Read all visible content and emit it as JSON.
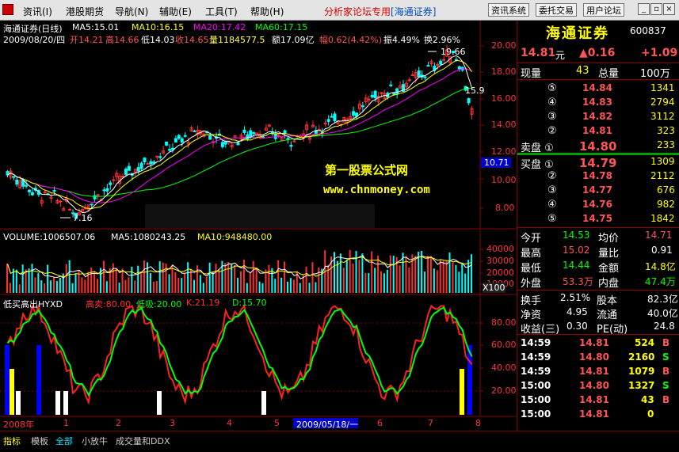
{
  "menu": {
    "items": [
      "资讯(I)",
      "港股期货",
      "导航(N)",
      "辅助(E)",
      "工具(T)",
      "帮助(H)"
    ],
    "special_text": "分析家论坛专用",
    "special_link": "[海通证券]",
    "right_buttons": [
      "资讯系统",
      "委托交易",
      "用户论坛"
    ]
  },
  "chart": {
    "title": "海通证券(日线)",
    "ma_info": [
      {
        "label": "MA5:15.01",
        "color": "#ffffff"
      },
      {
        "label": "MA10:16.15",
        "color": "#ffff00"
      },
      {
        "label": "MA20:17.42",
        "color": "#ff00ff"
      },
      {
        "label": "MA60:17.15",
        "color": "#00ff00"
      }
    ],
    "date_line": "2009/08/20/四",
    "ohlc": [
      {
        "text": "开14.21",
        "color": "#ff5555"
      },
      {
        "text": "高14.66",
        "color": "#ff5555"
      },
      {
        "text": "低14.03",
        "color": "#ffffff"
      },
      {
        "text": "收14.65",
        "color": "#ff5555"
      },
      {
        "text": "量1184577.5",
        "color": "#ffff55"
      },
      {
        "text": "额17.09亿",
        "color": "#ffffff"
      },
      {
        "text": "幅0.62(4.42%)",
        "color": "#ff5555"
      },
      {
        "text": "振4.49%",
        "color": "#ffffff"
      },
      {
        "text": "换2.96%",
        "color": "#ffffff"
      }
    ],
    "watermark1": "第一股票公式网",
    "watermark2": "www.chnmoney.com",
    "high_label": "19.66",
    "low_label": "7.16",
    "mid_label": "15.9",
    "price_tag": "10.71",
    "price_axis": [
      "20.00",
      "18.00",
      "16.00",
      "14.00",
      "12.00",
      "10.00",
      "8.00"
    ],
    "volume_info": [
      {
        "label": "VOLUME:1006507.06",
        "color": "#ffffff"
      },
      {
        "label": "MA5:1080243.25",
        "color": "#ffffff"
      },
      {
        "label": "MA10:948480.00",
        "color": "#ffff00"
      }
    ],
    "volume_axis": [
      "40000",
      "30000",
      "20000",
      "10000"
    ],
    "volume_unit": "X100",
    "indicator_name": "低买高出HYXD",
    "indicator_values": [
      {
        "text": "高卖:80.00",
        "color": "#ff3333"
      },
      {
        "text": "低吸:20.00",
        "color": "#00ff00"
      },
      {
        "text": "K:21.19",
        "color": "#ff3333"
      },
      {
        "text": "D:15.70",
        "color": "#00ff00"
      }
    ],
    "indicator_axis": [
      "80.00",
      "60.00",
      "40.00",
      "20.00"
    ],
    "time_axis": [
      "2008年",
      "1",
      "2",
      "3",
      "4",
      "5",
      "6",
      "7",
      "8"
    ],
    "date_tag": "2009/05/18/一"
  },
  "panel": {
    "stock_name": "海通证券",
    "stock_code": "600837",
    "price": "14.81",
    "price_unit": "元",
    "change": "▲0.16",
    "change_pct": "+1.09",
    "xianliang_label": "现量",
    "xianliang": "43",
    "zongliang_label": "总量",
    "zongliang": "100万",
    "sell": [
      {
        "label": "⑤",
        "price": "14.84",
        "vol": "1341"
      },
      {
        "label": "④",
        "price": "14.83",
        "vol": "2794"
      },
      {
        "label": "③",
        "price": "14.82",
        "vol": "3112"
      },
      {
        "label": "②",
        "price": "14.81",
        "vol": "323"
      },
      {
        "label": "卖盘 ①",
        "price": "14.80",
        "vol": "233"
      }
    ],
    "buy": [
      {
        "label": "买盘 ①",
        "price": "14.79",
        "vol": "1309"
      },
      {
        "label": "②",
        "price": "14.78",
        "vol": "2112"
      },
      {
        "label": "③",
        "price": "14.77",
        "vol": "676"
      },
      {
        "label": "④",
        "price": "14.76",
        "vol": "982"
      },
      {
        "label": "⑤",
        "price": "14.75",
        "vol": "1842"
      }
    ],
    "stats": [
      {
        "l1": "今开",
        "v1": "14.53",
        "c1": "#00ff00",
        "l2": "均价",
        "v2": "14.71",
        "c2": "#ff5555"
      },
      {
        "l1": "最高",
        "v1": "15.02",
        "c1": "#ff5555",
        "l2": "量比",
        "v2": "0.91",
        "c2": "#ffffff"
      },
      {
        "l1": "最低",
        "v1": "14.44",
        "c1": "#00ff00",
        "l2": "金额",
        "v2": "14.8亿",
        "c2": "#ffff00"
      },
      {
        "l1": "外盘",
        "v1": "53.3万",
        "c1": "#ff5555",
        "l2": "内盘",
        "v2": "47.4万",
        "c2": "#00ff00"
      }
    ],
    "fund": [
      {
        "l1": "换手",
        "v1": "2.51%",
        "l2": "股本",
        "v2": "82.3亿"
      },
      {
        "l1": "净资",
        "v1": "4.95",
        "l2": "流通",
        "v2": "40.0亿"
      },
      {
        "l1": "收益(三)",
        "v1": "0.30",
        "l2": "PE(动)",
        "v2": "24.8"
      }
    ],
    "ticks": [
      {
        "time": "14:59",
        "price": "14.81",
        "vol": "524",
        "dir": "B",
        "color": "#ff5555"
      },
      {
        "time": "14:59",
        "price": "14.80",
        "vol": "2160",
        "dir": "S",
        "color": "#00ff00"
      },
      {
        "time": "14:59",
        "price": "14.81",
        "vol": "1079",
        "dir": "B",
        "color": "#ff5555"
      },
      {
        "time": "15:00",
        "price": "14.80",
        "vol": "1327",
        "dir": "S",
        "color": "#00ff00"
      },
      {
        "time": "15:00",
        "price": "14.81",
        "vol": "43",
        "dir": "B",
        "color": "#ff5555"
      },
      {
        "time": "15:00",
        "price": "14.81",
        "vol": "0",
        "dir": "",
        "color": "#ffff00"
      }
    ]
  },
  "tabs": [
    "指标",
    "模板",
    "全部",
    "小放牛",
    "成交量和DDX"
  ]
}
